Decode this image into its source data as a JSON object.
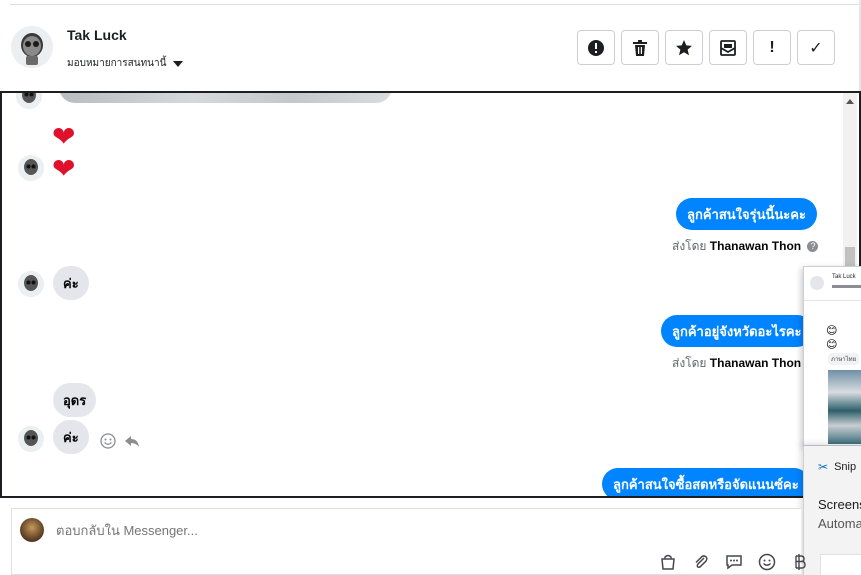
{
  "header": {
    "name": "Tak Luck",
    "assign_label": "มอบหมายการสนทนานี้"
  },
  "toolbar": {
    "spam_label": "!",
    "important_label": "!",
    "done_label": "✓"
  },
  "messages": {
    "heart1": "❤",
    "heart2": "❤",
    "out1": "ลูกค้าสนใจรุ่นนี้นะคะ",
    "sent_prefix": "ส่งโดย",
    "agent_name": "Thanawan Thon",
    "in1": "ค่ะ",
    "out2": "ลูกค้าอยู่จังหวัดอะไรคะ",
    "in2": "อุดร",
    "in3": "ค่ะ",
    "out3": "ลูกค้าสนใจซื้อสดหรือจัดแนนซ์คะ"
  },
  "popup": {
    "name": "Tak Luck",
    "emoji1": "😊",
    "emoji2": "😊",
    "chip": "ภาษาไทย"
  },
  "toast": {
    "app_name": "Snip",
    "title": "Screens",
    "body": "Automa"
  },
  "composer": {
    "placeholder": "ตอบกลับใน Messenger..."
  }
}
